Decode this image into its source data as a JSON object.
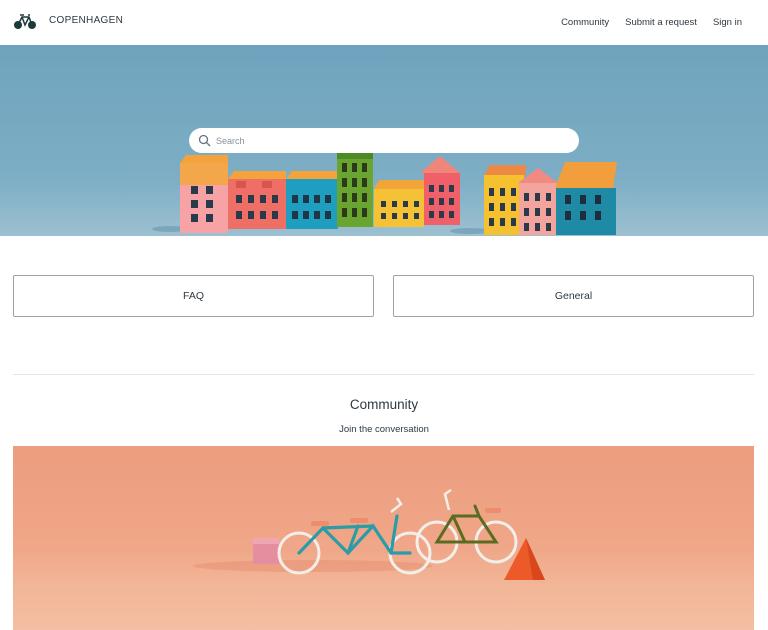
{
  "header": {
    "brand": "COPENHAGEN",
    "nav": [
      "Community",
      "Submit a request",
      "Sign in"
    ]
  },
  "hero": {
    "search_placeholder": "Search"
  },
  "categories": [
    "FAQ",
    "General"
  ],
  "community": {
    "title": "Community",
    "subtitle": "Join the conversation"
  },
  "colors": {
    "text": "#2f3941",
    "hero_sky": "#7daec5",
    "community_bg": "#f0a688",
    "block_border": "#9aa3ab"
  }
}
